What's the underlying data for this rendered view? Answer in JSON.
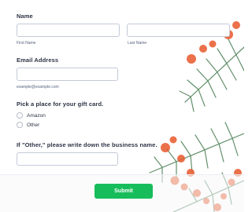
{
  "name_field": {
    "label": "Name",
    "first_sublabel": "First Name",
    "last_sublabel": "Last Name",
    "first_value": "",
    "last_value": ""
  },
  "email_field": {
    "label": "Email Address",
    "sublabel": "example@example.com",
    "value": ""
  },
  "gift_card": {
    "label": "Pick a place for your gift card.",
    "options": [
      {
        "label": "Amazon"
      },
      {
        "label": "Other"
      }
    ]
  },
  "other_field": {
    "label": "If \"Other,\" please write down the business name.",
    "value": ""
  },
  "submit_label": "Submit",
  "colors": {
    "accent": "#18bd5b",
    "berry": "#e8592c",
    "pine": "#2f6b3a"
  },
  "background_decor": "pine-branch-with-berries"
}
